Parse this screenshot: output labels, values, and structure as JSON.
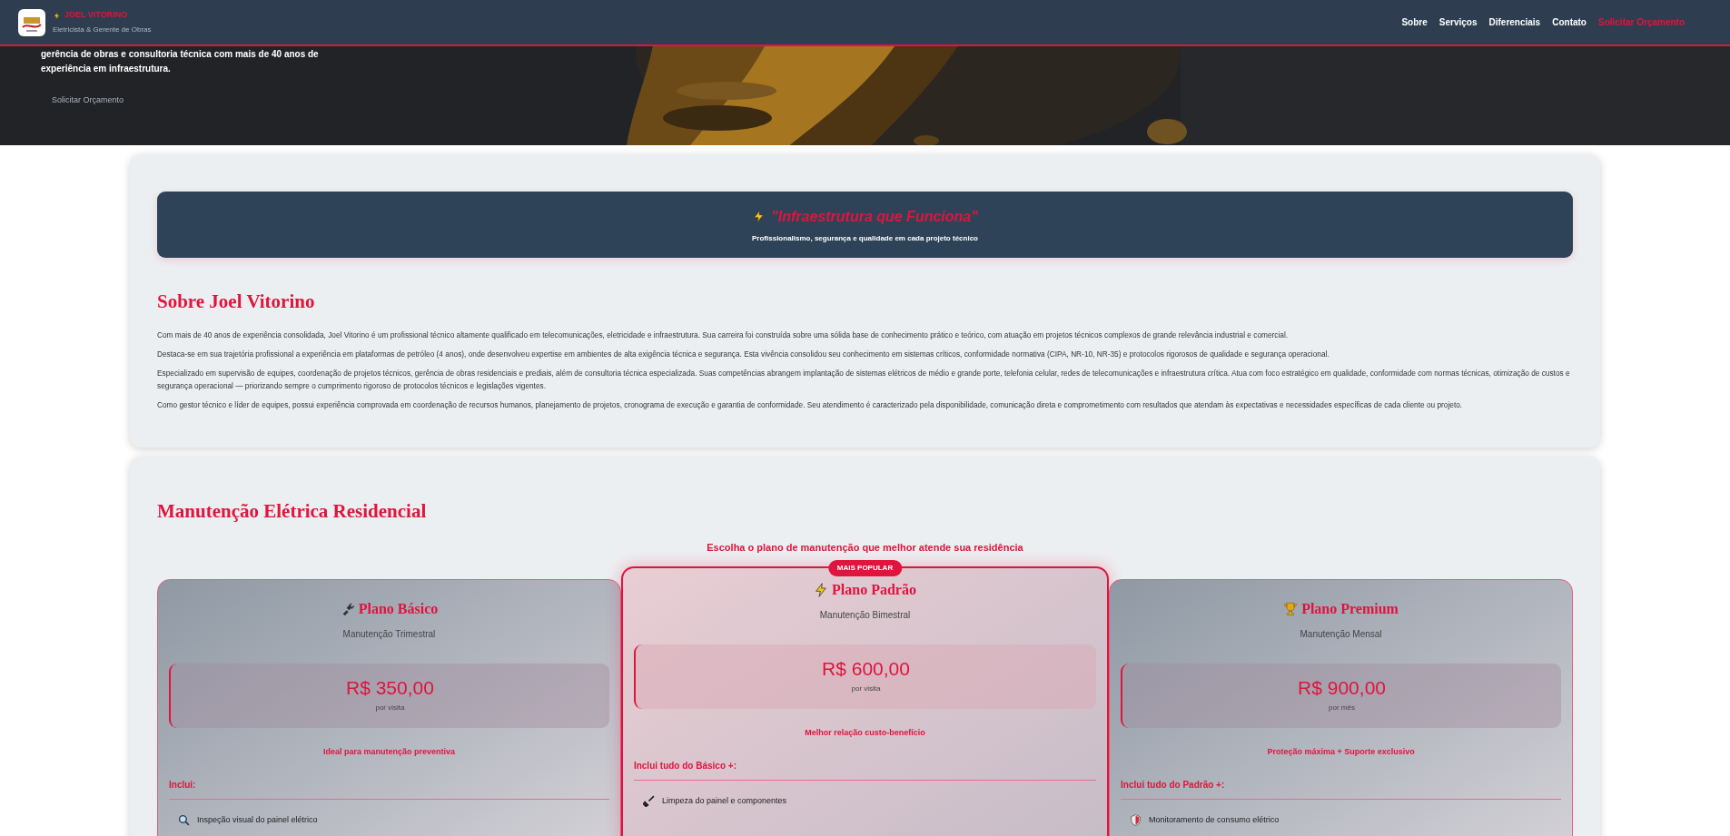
{
  "header": {
    "brand": {
      "name": "JOEL VITORINO",
      "tagline": "Eletricista & Gerente de Obras"
    },
    "nav": [
      {
        "label": "Sobre",
        "kind": "link"
      },
      {
        "label": "Serviços",
        "kind": "link"
      },
      {
        "label": "Diferenciais",
        "kind": "link"
      },
      {
        "label": "Contato",
        "kind": "link"
      },
      {
        "label": "Solicitar Orçamento",
        "kind": "cta"
      }
    ]
  },
  "hero": {
    "text": "gerência de obras e consultoria técnica com mais de 40 anos de experiência em infraestrutura.",
    "button": "Solicitar Orçamento"
  },
  "about": {
    "banner": {
      "title": "\"Infraestrutura que Funciona\"",
      "subtitle": "Profissionalismo, segurança e qualidade em cada projeto técnico"
    },
    "heading": "Sobre Joel Vitorino",
    "paragraphs": [
      "Com mais de 40 anos de experiência consolidada, Joel Vitorino é um profissional técnico altamente qualificado em telecomunicações, eletricidade e infraestrutura. Sua carreira foi construída sobre uma sólida base de conhecimento prático e teórico, com atuação em projetos técnicos complexos de grande relevância industrial e comercial.",
      "Destaca-se em sua trajetória profissional a experiência em plataformas de petróleo (4 anos), onde desenvolveu expertise em ambientes de alta exigência técnica e segurança. Esta vivência consolidou seu conhecimento em sistemas críticos, conformidade normativa (CIPA, NR-10, NR-35) e protocolos rigorosos de qualidade e segurança operacional.",
      "Especializado em supervisão de equipes, coordenação de projetos técnicos, gerência de obras residenciais e prediais, além de consultoria técnica especializada. Suas competências abrangem implantação de sistemas elétricos de médio e grande porte, telefonia celular, redes de telecomunicações e infraestrutura crítica. Atua com foco estratégico em qualidade, conformidade com normas técnicas, otimização de custos e segurança operacional — priorizando sempre o cumprimento rigoroso de protocolos técnicos e legislações vigentes.",
      "Como gestor técnico e líder de equipes, possui experiência comprovada em coordenação de recursos humanos, planejamento de projetos, cronograma de execução e garantia de conformidade. Seu atendimento é caracterizado pela disponibilidade, comunicação direta e comprometimento com resultados que atendam às expectativas e necessidades específicas de cada cliente ou projeto."
    ]
  },
  "plans_section": {
    "heading": "Manutenção Elétrica Residencial",
    "subtitle": "Escolha o plano de manutenção que melhor atende sua residência",
    "plans": [
      {
        "kind": "plug",
        "title": "Plano Básico",
        "frequency": "Manutenção Trimestral",
        "price": "R$ 350,00",
        "period": "por visita",
        "highlight": "Ideal para manutenção preventiva",
        "includes": "Inclui:",
        "featured": false,
        "features": [
          {
            "kind": "magnifier",
            "text": "Inspeção visual do painel elétrico"
          }
        ]
      },
      {
        "kind": "bolt",
        "title": "Plano Padrão",
        "frequency": "Manutenção Bimestral",
        "price": "R$ 600,00",
        "period": "por visita",
        "highlight": "Melhor relação custo-benefício",
        "includes": "Inclui tudo do Básico +:",
        "featured": true,
        "badge": "MAIS POPULAR",
        "features": [
          {
            "kind": "broom",
            "text": "Limpeza do painel e componentes"
          }
        ]
      },
      {
        "kind": "trophy",
        "title": "Plano Premium",
        "frequency": "Manutenção Mensal",
        "price": "R$ 900,00",
        "period": "por mês",
        "highlight": "Proteção máxima + Suporte exclusivo",
        "includes": "Inclui tudo do Padrão +:",
        "featured": false,
        "features": [
          {
            "kind": "shield",
            "text": "Monitoramento de consumo elétrico"
          }
        ]
      }
    ]
  }
}
